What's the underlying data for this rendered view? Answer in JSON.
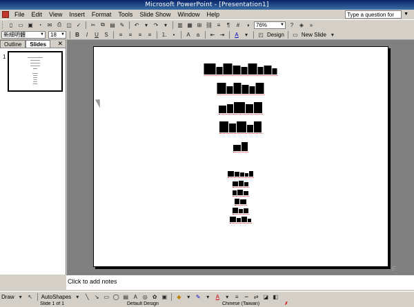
{
  "window": {
    "title": "Microsoft PowerPoint - [Presentation1]"
  },
  "menu": {
    "items": [
      {
        "label": "File",
        "key": "F"
      },
      {
        "label": "Edit",
        "key": "E"
      },
      {
        "label": "View",
        "key": "V"
      },
      {
        "label": "Insert",
        "key": "I"
      },
      {
        "label": "Format",
        "key": "o"
      },
      {
        "label": "Tools",
        "key": "T"
      },
      {
        "label": "Slide Show",
        "key": "S"
      },
      {
        "label": "Window",
        "key": "W"
      },
      {
        "label": "Help",
        "key": "H"
      }
    ],
    "help_placeholder": "Type a question for help"
  },
  "standard_toolbar": {
    "zoom": "76%"
  },
  "formatting_toolbar": {
    "font": "新細明體",
    "size": "18",
    "design_label": "Design",
    "new_slide_label": "New Slide"
  },
  "left_pane": {
    "tabs": [
      {
        "label": "Outline",
        "active": false
      },
      {
        "label": "Slides",
        "active": true
      }
    ],
    "slide_number": "1"
  },
  "notes": {
    "placeholder": "Click to add notes"
  },
  "drawing_toolbar": {
    "draw_label": "Draw",
    "autoshapes_label": "AutoShapes"
  },
  "status": {
    "slide": "Slide 1 of 1",
    "design": "Default Design",
    "language": "Chinese (Taiwan)"
  }
}
